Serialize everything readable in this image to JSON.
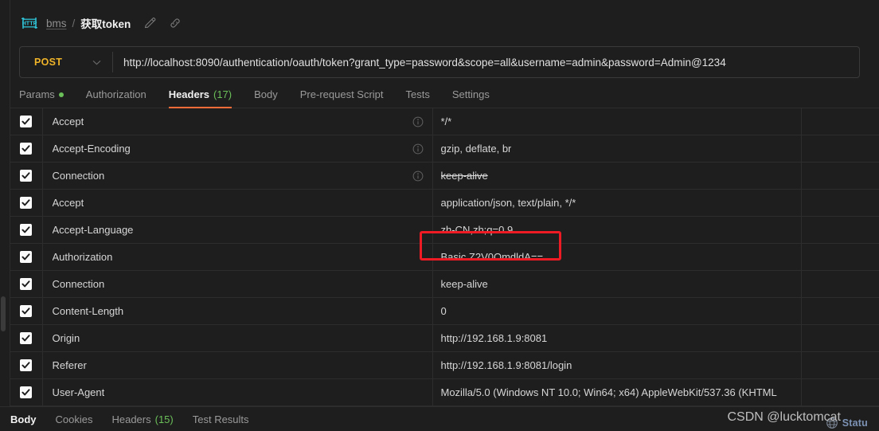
{
  "breadcrumb": {
    "protocol_icon": "http-icon",
    "collection": "bms",
    "separator": "/",
    "request_name": "获取token",
    "edit_icon": "pencil-icon",
    "link_icon": "link-icon"
  },
  "url_bar": {
    "method": "POST",
    "method_chevron": "chevron-down-icon",
    "url": "http://localhost:8090/authentication/oauth/token?grant_type=password&scope=all&username=admin&password=Admin@1234"
  },
  "request_tabs": [
    {
      "label": "Params",
      "active": false,
      "dot": true,
      "count": ""
    },
    {
      "label": "Authorization",
      "active": false,
      "dot": false,
      "count": ""
    },
    {
      "label": "Headers",
      "active": true,
      "dot": false,
      "count": "(17)"
    },
    {
      "label": "Body",
      "active": false,
      "dot": false,
      "count": ""
    },
    {
      "label": "Pre-request Script",
      "active": false,
      "dot": false,
      "count": ""
    },
    {
      "label": "Tests",
      "active": false,
      "dot": false,
      "count": ""
    },
    {
      "label": "Settings",
      "active": false,
      "dot": false,
      "count": ""
    }
  ],
  "headers_table": {
    "rows": [
      {
        "checked": true,
        "key": "Accept",
        "info": true,
        "value": "*/*",
        "strike": false,
        "highlight": false
      },
      {
        "checked": true,
        "key": "Accept-Encoding",
        "info": true,
        "value": "gzip, deflate, br",
        "strike": false,
        "highlight": false
      },
      {
        "checked": true,
        "key": "Connection",
        "info": true,
        "value": "keep-alive",
        "strike": true,
        "highlight": false
      },
      {
        "checked": true,
        "key": "Accept",
        "info": false,
        "value": "application/json, text/plain, */*",
        "strike": false,
        "highlight": false
      },
      {
        "checked": true,
        "key": "Accept-Language",
        "info": false,
        "value": "zh-CN,zh;q=0.9",
        "strike": false,
        "highlight": false
      },
      {
        "checked": true,
        "key": "Authorization",
        "info": false,
        "value": "Basic Z2V0OmdldA==",
        "strike": false,
        "highlight": true
      },
      {
        "checked": true,
        "key": "Connection",
        "info": false,
        "value": "keep-alive",
        "strike": false,
        "highlight": false
      },
      {
        "checked": true,
        "key": "Content-Length",
        "info": false,
        "value": "0",
        "strike": false,
        "highlight": false
      },
      {
        "checked": true,
        "key": "Origin",
        "info": false,
        "value": "http://192.168.1.9:8081",
        "strike": false,
        "highlight": false
      },
      {
        "checked": true,
        "key": "Referer",
        "info": false,
        "value": "http://192.168.1.9:8081/login",
        "strike": false,
        "highlight": false
      },
      {
        "checked": true,
        "key": "User-Agent",
        "info": false,
        "value": "Mozilla/5.0 (Windows NT 10.0; Win64; x64) AppleWebKit/537.36 (KHTML",
        "strike": false,
        "highlight": false
      },
      {
        "checked": true,
        "key": "",
        "info": false,
        "value": "",
        "strike": false,
        "highlight": false
      }
    ]
  },
  "response_tabs": [
    {
      "label": "Body",
      "active": true,
      "count": ""
    },
    {
      "label": "Cookies",
      "active": false,
      "count": ""
    },
    {
      "label": "Headers",
      "active": false,
      "count": "(15)"
    },
    {
      "label": "Test Results",
      "active": false,
      "count": ""
    }
  ],
  "status_bar": {
    "globe_icon": "globe-icon",
    "status_label": "Statu"
  },
  "watermark": {
    "text": "CSDN @lucktomcat"
  },
  "colors": {
    "background": "#1e1e1e",
    "method_accent": "#f0b429",
    "active_tab_underline": "#ff6c37",
    "count_green": "#6bbf59",
    "annotation_red": "#ee1b24",
    "http_icon_cyan": "#2fc4d8"
  }
}
